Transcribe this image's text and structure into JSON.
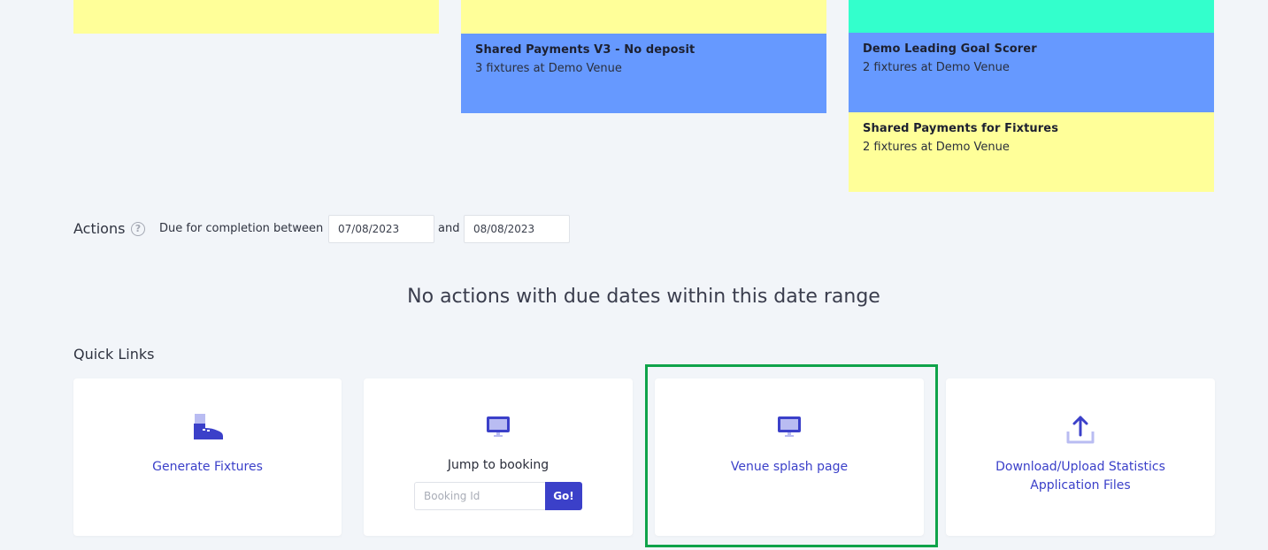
{
  "fixtures": {
    "cards": [
      {
        "title": "Shared Payments V3 - No deposit",
        "subtitle": "3 fixtures at Demo Venue"
      },
      {
        "title": "Demo Leading Goal Scorer",
        "subtitle": "2 fixtures at Demo Venue"
      },
      {
        "title": "Shared Payments for Fixtures",
        "subtitle": "2 fixtures at Demo Venue"
      }
    ],
    "colors": {
      "yellow": "#ffff99",
      "blue": "#6699ff",
      "teal": "#33ffcc"
    }
  },
  "actions": {
    "label": "Actions",
    "help_glyph": "?",
    "due_label": "Due for completion between",
    "from_date": "07/08/2023",
    "and_label": "and",
    "to_date": "08/08/2023",
    "empty_message": "No actions with due dates within this date range"
  },
  "quick_links": {
    "label": "Quick Links",
    "items": [
      {
        "label": "Generate Fixtures",
        "icon": "boot-icon"
      },
      {
        "label": "Jump to booking",
        "icon": "monitor-icon",
        "input_placeholder": "Booking Id",
        "button_label": "Go!"
      },
      {
        "label": "Venue splash page",
        "icon": "monitor-icon"
      },
      {
        "label_line1": "Download/Upload Statistics",
        "label_line2": "Application Files",
        "icon": "upload-icon"
      }
    ]
  },
  "accent_color": "#3b40c9",
  "highlight_color": "#0fa34a"
}
